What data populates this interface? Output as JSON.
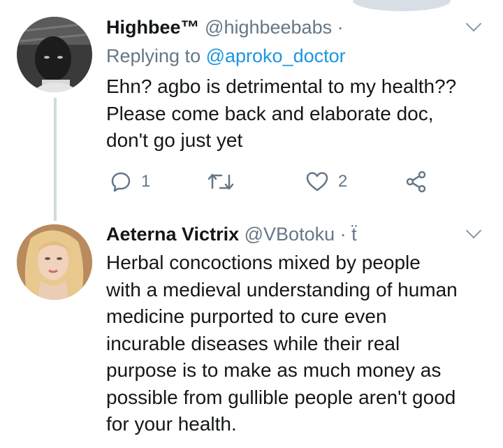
{
  "tweets": [
    {
      "display_name": "Highbee™",
      "handle": "@highbeebabs ·",
      "replying_prefix": "Replying to",
      "replying_to": "@aproko_doctor",
      "lines": [
        "Ehn? agbo is detrimental to my health??",
        "Please come back and elaborate doc,",
        "don't go just yet"
      ],
      "reply_count": "1",
      "like_count": "2"
    },
    {
      "display_name": "Aeterna Victrix",
      "handle": "@VBotoku · ẗ",
      "lines": [
        "Herbal concoctions mixed by people",
        "with a medieval understanding of human",
        "medicine purported to cure even",
        "incurable diseases while their real",
        "purpose is to make as much money as",
        "possible from gullible people aren't good",
        "for your health."
      ]
    }
  ],
  "colors": {
    "text": "#14171a",
    "secondary": "#657786",
    "link": "#1b95e0",
    "thread_line": "#cfd9de"
  },
  "icons": [
    "reply-icon",
    "retweet-icon",
    "like-icon",
    "share-icon",
    "chevron-down-icon"
  ]
}
